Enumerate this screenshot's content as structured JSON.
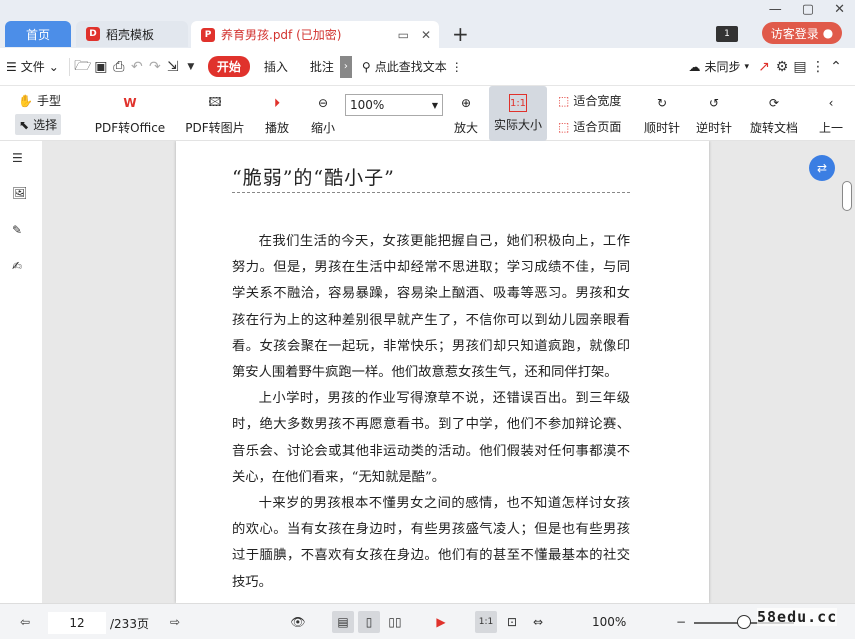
{
  "tabs": {
    "home": "首页",
    "template": "稻壳模板",
    "document": "养育男孩.pdf (已加密)"
  },
  "header": {
    "page_badge": "1",
    "login": "访客登录"
  },
  "menu": {
    "file": "文件",
    "start": "开始",
    "insert": "插入",
    "annotate": "批注",
    "search_text": "点此查找文本",
    "sync": "未同步"
  },
  "ribbon": {
    "hand": "手型",
    "select": "选择",
    "pdf_to_office": "PDF转Office",
    "pdf_to_image": "PDF转图片",
    "play": "播放",
    "zoom_out": "缩小",
    "zoom_value": "100%",
    "zoom_in": "放大",
    "actual_size": "实际大小",
    "fit_width": "适合宽度",
    "fit_page": "适合页面",
    "rotate_cw": "顺时针",
    "rotate_ccw": "逆时针",
    "rotate_doc": "旋转文档",
    "prev": "上一"
  },
  "document": {
    "title": "“脆弱”的“酷小子”",
    "paragraphs": [
      "在我们生活的今天，女孩更能把握自己，她们积极向上，工作努力。但是，男孩在生活中却经常不思进取；学习成绩不佳，与同学关系不融洽，容易暴躁，容易染上酗酒、吸毒等恶习。男孩和女孩在行为上的这种差别很早就产生了，不信你可以到幼儿园亲眼看看。女孩会聚在一起玩，非常快乐；男孩们却只知道疯跑，就像印第安人围着野牛疯跑一样。他们故意惹女孩生气，还和同伴打架。",
      "上小学时，男孩的作业写得潦草不说，还错误百出。到三年级时，绝大多数男孩不再愿意看书。到了中学，他们不参加辩论赛、音乐会、讨论会或其他非运动类的活动。他们假装对任何事都漠不关心，在他们看来，“无知就是酷”。",
      "十来岁的男孩根本不懂男女之间的感情，也不知道怎样讨女孩的欢心。当有女孩在身边时，有些男孩盛气凌人；但是也有些男孩过于腼腆，不喜欢有女孩在身边。他们有的甚至不懂最基本的社交技巧。"
    ]
  },
  "status": {
    "current_page": "12",
    "total_pages": "/233页",
    "zoom": "100%"
  },
  "watermark": "58edu.cc",
  "colors": {
    "accent_blue": "#4c8ee8",
    "brand_red": "#e0322c"
  }
}
